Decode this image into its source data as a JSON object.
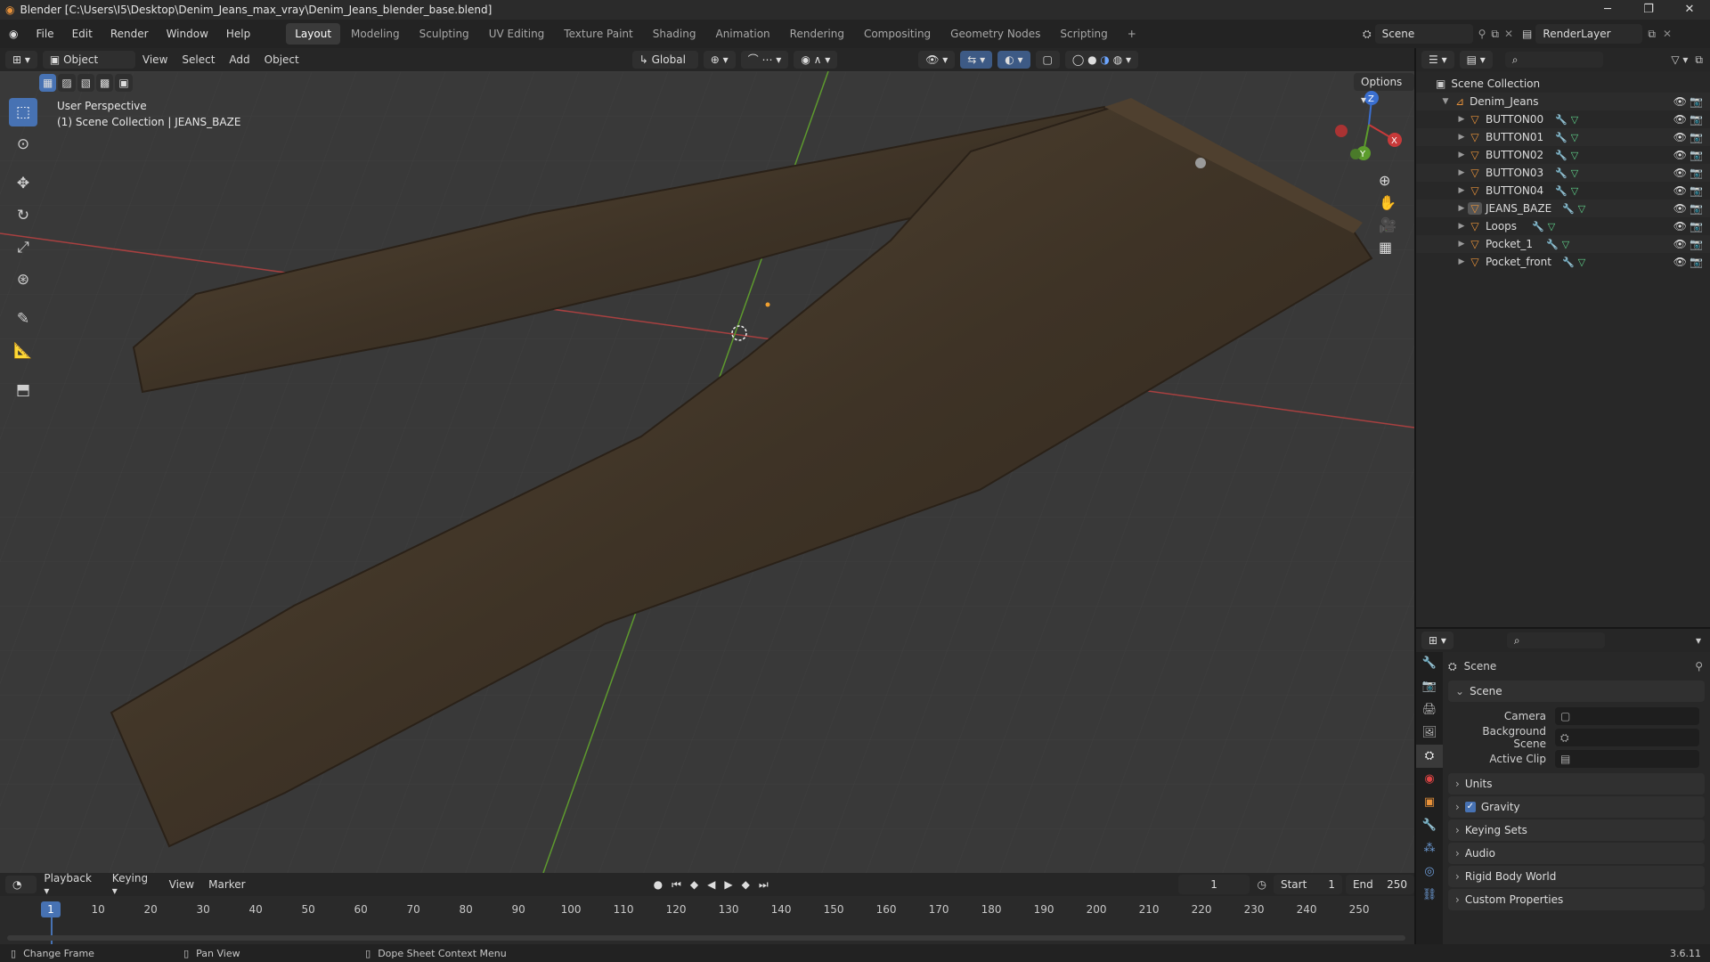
{
  "titlebar": {
    "title": "Blender [C:\\Users\\I5\\Desktop\\Denim_Jeans_max_vray\\Denim_Jeans_blender_base.blend]",
    "min": "─",
    "max": "❐",
    "close": "✕"
  },
  "menu": [
    "File",
    "Edit",
    "Render",
    "Window",
    "Help"
  ],
  "workspaces": [
    "Layout",
    "Modeling",
    "Sculpting",
    "UV Editing",
    "Texture Paint",
    "Shading",
    "Animation",
    "Rendering",
    "Compositing",
    "Geometry Nodes",
    "Scripting",
    "+"
  ],
  "scene_name": "Scene",
  "render_layer": "RenderLayer",
  "viewport": {
    "mode": "Object Mode",
    "menus": [
      "View",
      "Select",
      "Add",
      "Object"
    ],
    "transform": "Global",
    "options": "Options",
    "overlay_line1": "User Perspective",
    "overlay_line2": "(1) Scene Collection | JEANS_BAZE",
    "gizmo_axes": [
      "Z",
      "X",
      "Y"
    ]
  },
  "outliner": {
    "root": "Scene Collection",
    "collection": "Denim_Jeans",
    "objects": [
      "BUTTON00",
      "BUTTON01",
      "BUTTON02",
      "BUTTON03",
      "BUTTON04",
      "JEANS_BAZE",
      "Loops",
      "Pocket_1",
      "Pocket_front"
    ]
  },
  "properties": {
    "header": "Scene",
    "section": "Scene",
    "camera_label": "Camera",
    "background_label": "Background Scene",
    "clip_label": "Active Clip",
    "panels": [
      "Units",
      "Gravity",
      "Keying Sets",
      "Audio",
      "Rigid Body World",
      "Custom Properties"
    ]
  },
  "timeline": {
    "menus": [
      "Playback",
      "Keying",
      "View",
      "Marker"
    ],
    "current_frame": "1",
    "start_label": "Start",
    "start": "1",
    "end_label": "End",
    "end": "250",
    "ticks": [
      "1",
      "10",
      "20",
      "30",
      "40",
      "50",
      "60",
      "70",
      "80",
      "90",
      "100",
      "110",
      "120",
      "130",
      "140",
      "150",
      "160",
      "170",
      "180",
      "190",
      "200",
      "210",
      "220",
      "230",
      "240",
      "250"
    ]
  },
  "status": {
    "left": "Change Frame",
    "mid": "Pan View",
    "right": "Dope Sheet Context Menu",
    "version": "3.6.11"
  },
  "colors": {
    "accent": "#4772b3",
    "object": "#e8923a",
    "mesh": "#5fd18a",
    "modifier": "#6d9cd8",
    "denim": "#4a3d2e"
  }
}
